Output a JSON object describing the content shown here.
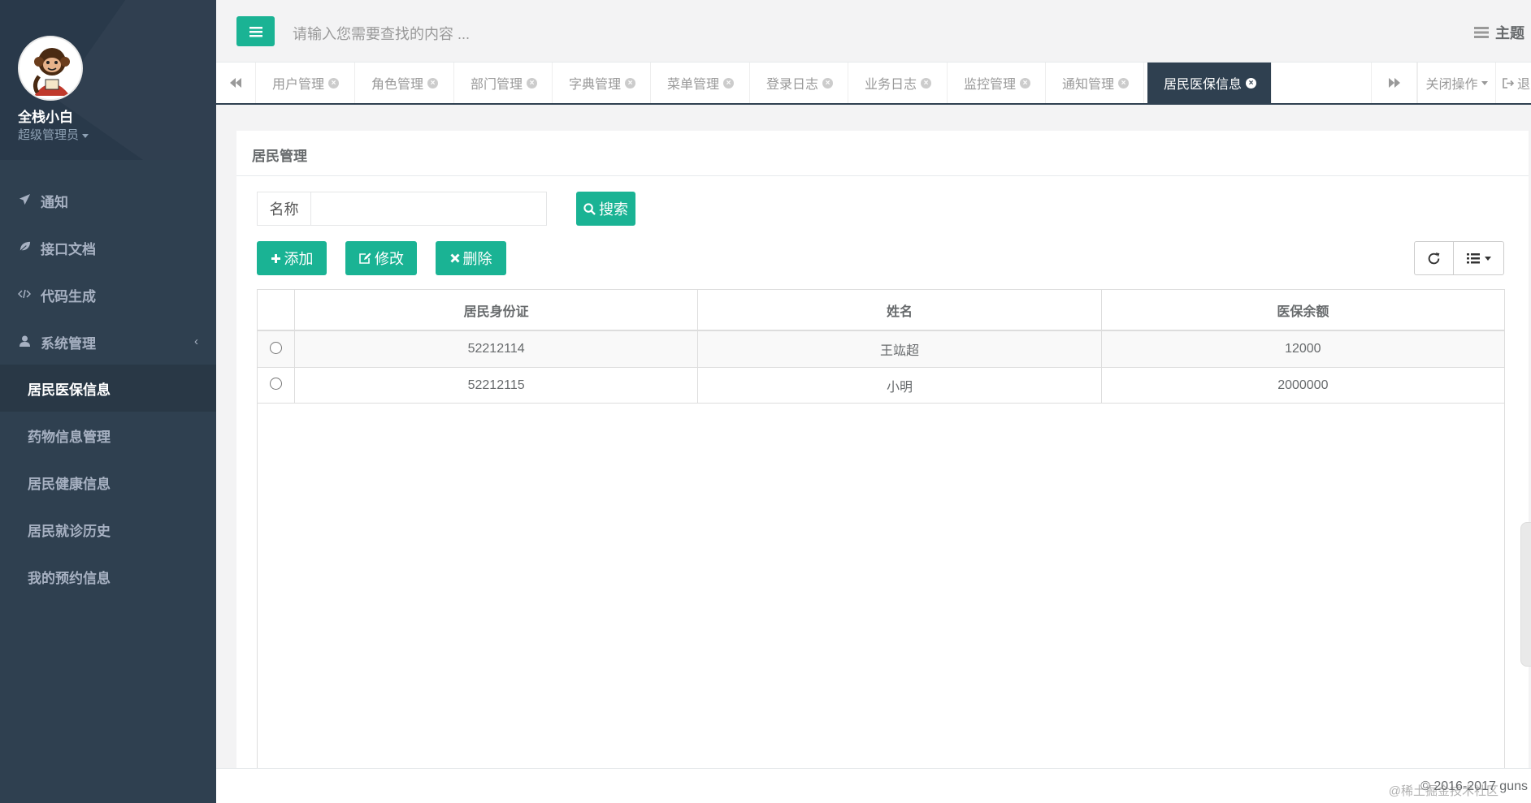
{
  "sidebar": {
    "user_name": "全栈小白",
    "user_role": "超级管理员",
    "menu": [
      {
        "label": "通知",
        "icon": "paper-plane-icon"
      },
      {
        "label": "接口文档",
        "icon": "leaf-icon"
      },
      {
        "label": "代码生成",
        "icon": "code-icon"
      },
      {
        "label": "系统管理",
        "icon": "user-icon",
        "chevron": "‹"
      }
    ],
    "submenu": [
      {
        "label": "居民医保信息",
        "active": true
      },
      {
        "label": "药物信息管理"
      },
      {
        "label": "居民健康信息"
      },
      {
        "label": "居民就诊历史"
      },
      {
        "label": "我的预约信息"
      }
    ]
  },
  "topbar": {
    "search_placeholder": "请输入您需要查找的内容 ...",
    "theme_label": "主题"
  },
  "tabs": {
    "items": [
      "用户管理",
      "角色管理",
      "部门管理",
      "字典管理",
      "菜单管理",
      "登录日志",
      "业务日志",
      "监控管理",
      "通知管理",
      "居民医保信息"
    ],
    "active_index": 9,
    "close_ops_label": "关闭操作",
    "logout_label": "退"
  },
  "panel": {
    "title": "居民管理",
    "filter_label": "名称",
    "filter_value": "",
    "search_button": "搜索",
    "add_button": "添加",
    "edit_button": "修改",
    "delete_button": "删除"
  },
  "table": {
    "columns": [
      "居民身份证",
      "姓名",
      "医保余额"
    ],
    "rows": [
      [
        "52212114",
        "王竑超",
        "12000"
      ],
      [
        "52212115",
        "小明",
        "2000000"
      ]
    ]
  },
  "footer": {
    "copyright": "© 2016-2017 guns",
    "watermark": "@稀土掘金技术社区"
  },
  "colors": {
    "sidebar_bg": "#2f4050",
    "accent": "#1ab394",
    "active_tab": "#2f4050"
  }
}
